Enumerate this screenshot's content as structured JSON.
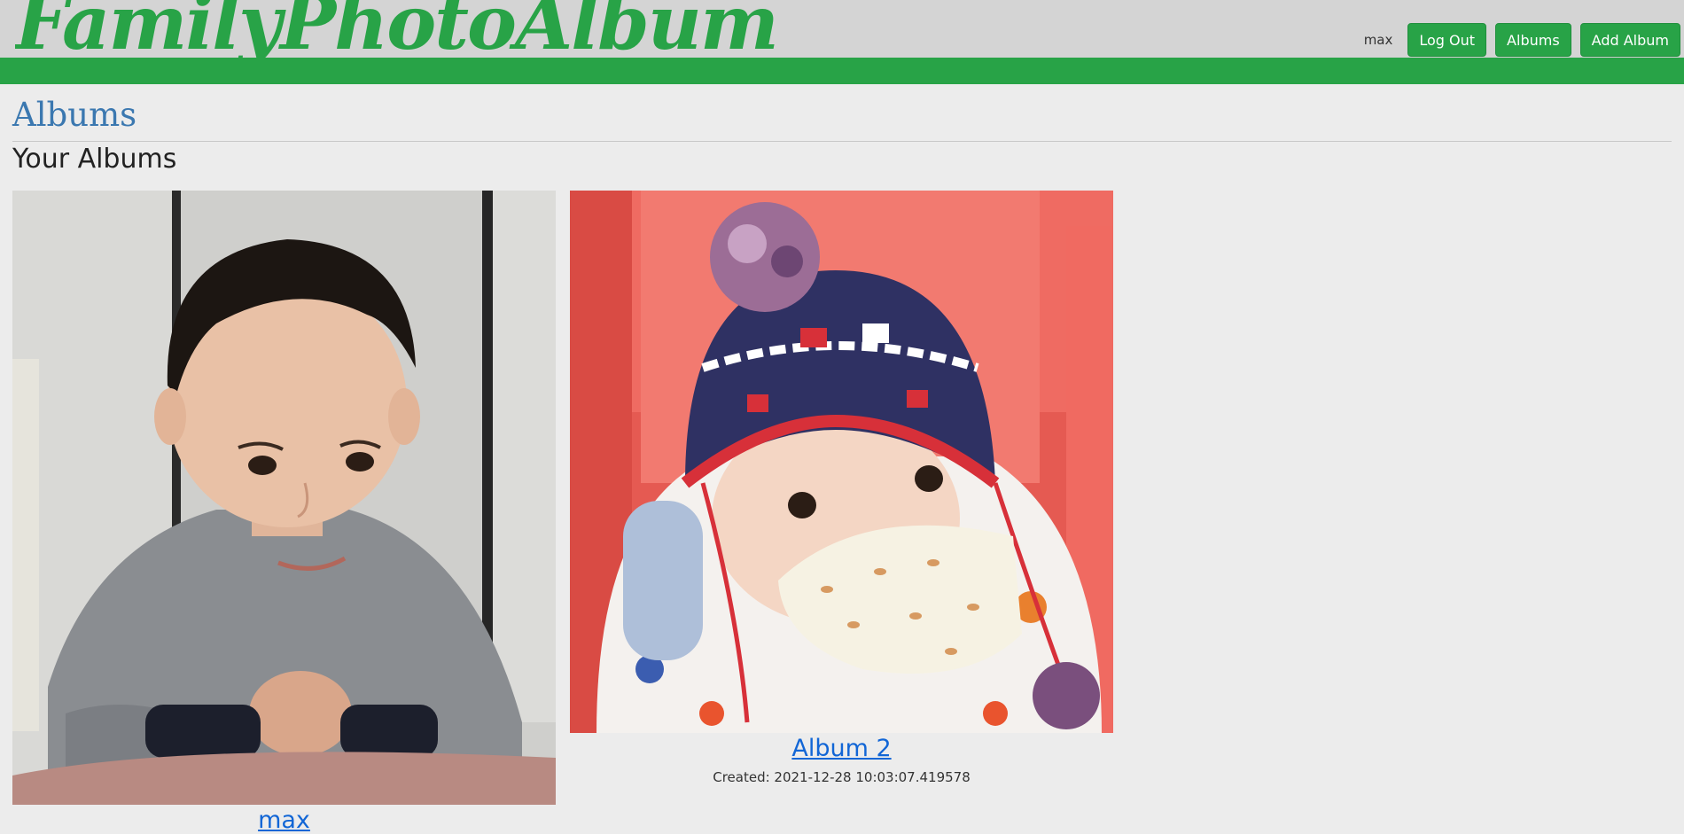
{
  "header": {
    "brand": "FamilyPhotoAlbum",
    "username": "max",
    "buttons": {
      "logout": "Log Out",
      "albums": "Albums",
      "add_album": "Add Album"
    }
  },
  "page": {
    "title": "Albums",
    "section_title": "Your Albums"
  },
  "albums": [
    {
      "title": "max",
      "photo": "boy-in-grey-sweater-photo"
    },
    {
      "title": "Album 2",
      "created": "Created: 2021-12-28 10:03:07.419578",
      "photo": "baby-in-knit-hat-photo"
    }
  ],
  "colors": {
    "brand_green": "#28a347",
    "header_grey": "#d4d4d4",
    "title_blue": "#3b78b0",
    "link_blue": "#1266d6"
  }
}
